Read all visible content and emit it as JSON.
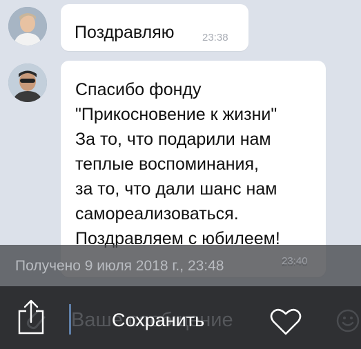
{
  "messages": [
    {
      "text": "Поздравляю",
      "time": "23:38"
    },
    {
      "text": "Спасибо фонду\n\"Прикосновение к жизни\"\nЗа то, что подарили нам\nтеплые воспоминания,\nза то, что дали шанс нам\nсамореализоваться.\nПоздравляем с юбилеем!",
      "time": "23:40"
    }
  ],
  "info_bar": {
    "received": "Получено 9 июля 2018 г., 23:48"
  },
  "input": {
    "placeholder": "Ваше сообщение"
  },
  "actions": {
    "save_label": "Сохранить",
    "share_icon": "share-icon",
    "like_icon": "heart-icon"
  },
  "colors": {
    "background": "#dce1ea",
    "bubble": "#ffffff",
    "toolbar": "#2f3033",
    "overlay": "#46484c"
  }
}
